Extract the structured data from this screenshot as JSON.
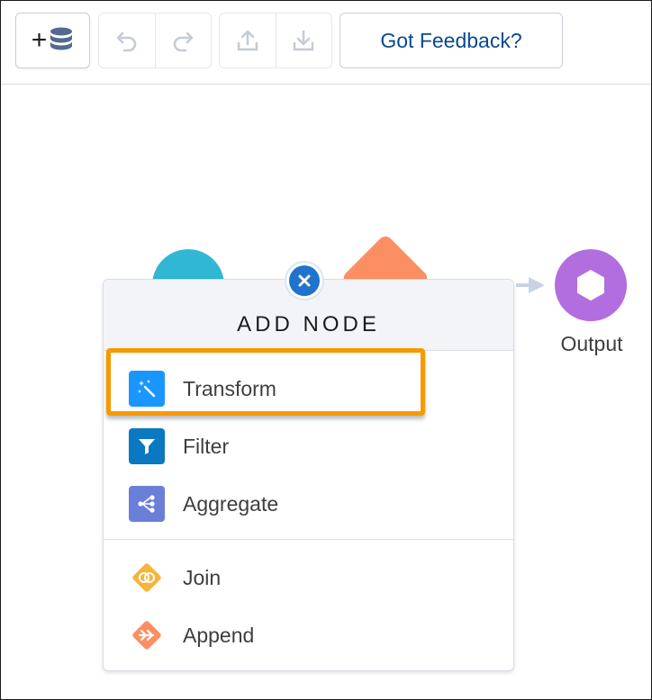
{
  "toolbar": {
    "add_data_plus": "+",
    "add_data_icon": "database-icon",
    "undo_icon": "undo-icon",
    "redo_icon": "redo-icon",
    "upload_icon": "upload-icon",
    "download_icon": "download-icon",
    "feedback_label": "Got Feedback?"
  },
  "canvas": {
    "output_label": "Output",
    "output_icon": "hexagon-icon"
  },
  "add_node_panel": {
    "title": "ADD NODE",
    "close_icon": "close-icon",
    "items": [
      {
        "label": "Transform",
        "icon": "magic-wand-icon",
        "color": "#1b96ff",
        "highlighted": true
      },
      {
        "label": "Filter",
        "icon": "filter-icon",
        "color": "#0b78c2"
      },
      {
        "label": "Aggregate",
        "icon": "aggregate-icon",
        "color": "#6a7fd8"
      }
    ],
    "items_secondary": [
      {
        "label": "Join",
        "icon": "join-icon",
        "color": "#f6b43d"
      },
      {
        "label": "Append",
        "icon": "append-icon",
        "color": "#fb8f63"
      }
    ]
  },
  "colors": {
    "highlight": "#f59a00",
    "accent": "#1f73cc",
    "output_node": "#b26ddf",
    "source_node": "#2fb7d3"
  }
}
